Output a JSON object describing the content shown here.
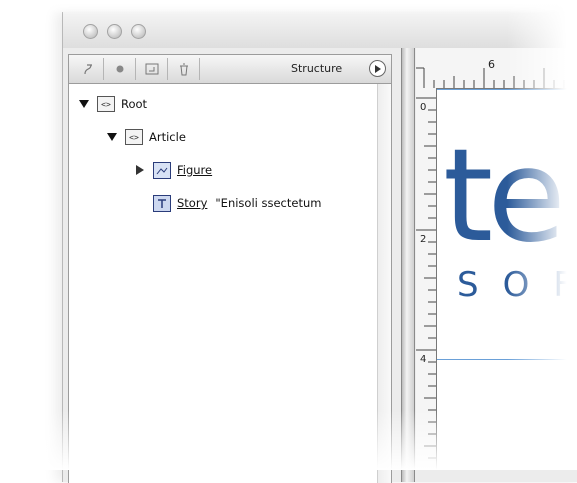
{
  "structure_panel": {
    "title": "Structure",
    "toolbar_icons": [
      "add-attribute-icon",
      "show-hide-attributes-icon",
      "new-element-icon",
      "delete-icon"
    ],
    "tree": {
      "root_label": "Root",
      "article_label": "Article",
      "figure_label": "Figure",
      "story_label": "Story",
      "story_text": "\"Enisoli ssectetum"
    }
  },
  "ruler": {
    "h_label": "6",
    "v_labels": [
      "0",
      "2",
      "4"
    ]
  },
  "document": {
    "logo_big": "te",
    "logo_small": "SOF"
  },
  "colors": {
    "logo": "#2c5b9a",
    "guide": "#6aa0d8"
  }
}
